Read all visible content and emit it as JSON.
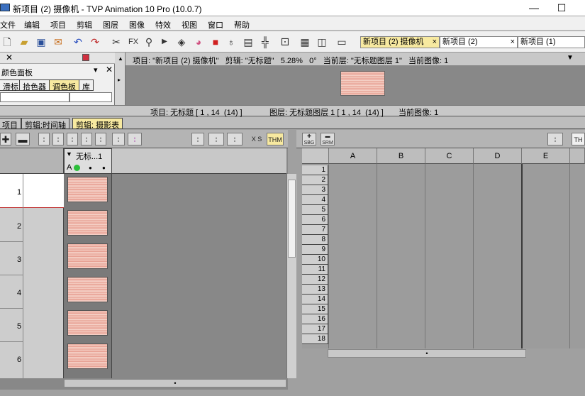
{
  "window": {
    "title": "新项目 (2) 摄像机 - TVP Animation 10 Pro (10.0.7)",
    "minimize": "—",
    "maximize": "☐"
  },
  "menu": [
    "文件",
    "编辑",
    "项目",
    "剪辑",
    "图层",
    "图像",
    "特效",
    "视图",
    "窗口",
    "帮助"
  ],
  "toolbar": {
    "fx_label": "FX",
    "doc_tabs": [
      "新项目 (2) 摄像机",
      "新项目 (2)",
      "新项目 (1)"
    ],
    "tab_close": "×"
  },
  "color_panel": {
    "title": "颜色面板",
    "tabs": [
      "滑标",
      "拾色器",
      "调色板",
      "库"
    ],
    "active_tab": "调色板"
  },
  "camera_bar": {
    "info": "项目: \"新项目 (2) 摄像机\"   剪辑: \"无标题\"   5.28%   0°   当前层: \"无标题图层 1\"   当前图像: 1"
  },
  "status_bar": {
    "project": "项目: 无标题 [ 1 , 14  (14) ]",
    "layer": "图层: 无标题图层 1 [ 1 , 14  (14) ]",
    "image": "当前图像: 1"
  },
  "lower_tabs": [
    "项目",
    "剪辑:时间轴",
    "剪辑: 摄影表"
  ],
  "exposure_sheet": {
    "layer_name": "无标...1",
    "layer_flags": "A",
    "row_labels": [
      "1",
      "2",
      "3",
      "4",
      "5",
      "6"
    ],
    "xs_label": "X S",
    "thm_label": "THM"
  },
  "spreadsheet": {
    "columns": [
      "A",
      "B",
      "C",
      "D",
      "E"
    ],
    "rows": [
      "1",
      "2",
      "3",
      "4",
      "5",
      "6",
      "7",
      "8",
      "9",
      "10",
      "11",
      "12",
      "13",
      "14",
      "15",
      "16",
      "17",
      "18"
    ],
    "toolbar_labels": [
      "SBG",
      "SRM"
    ],
    "thm_label": "TH"
  }
}
